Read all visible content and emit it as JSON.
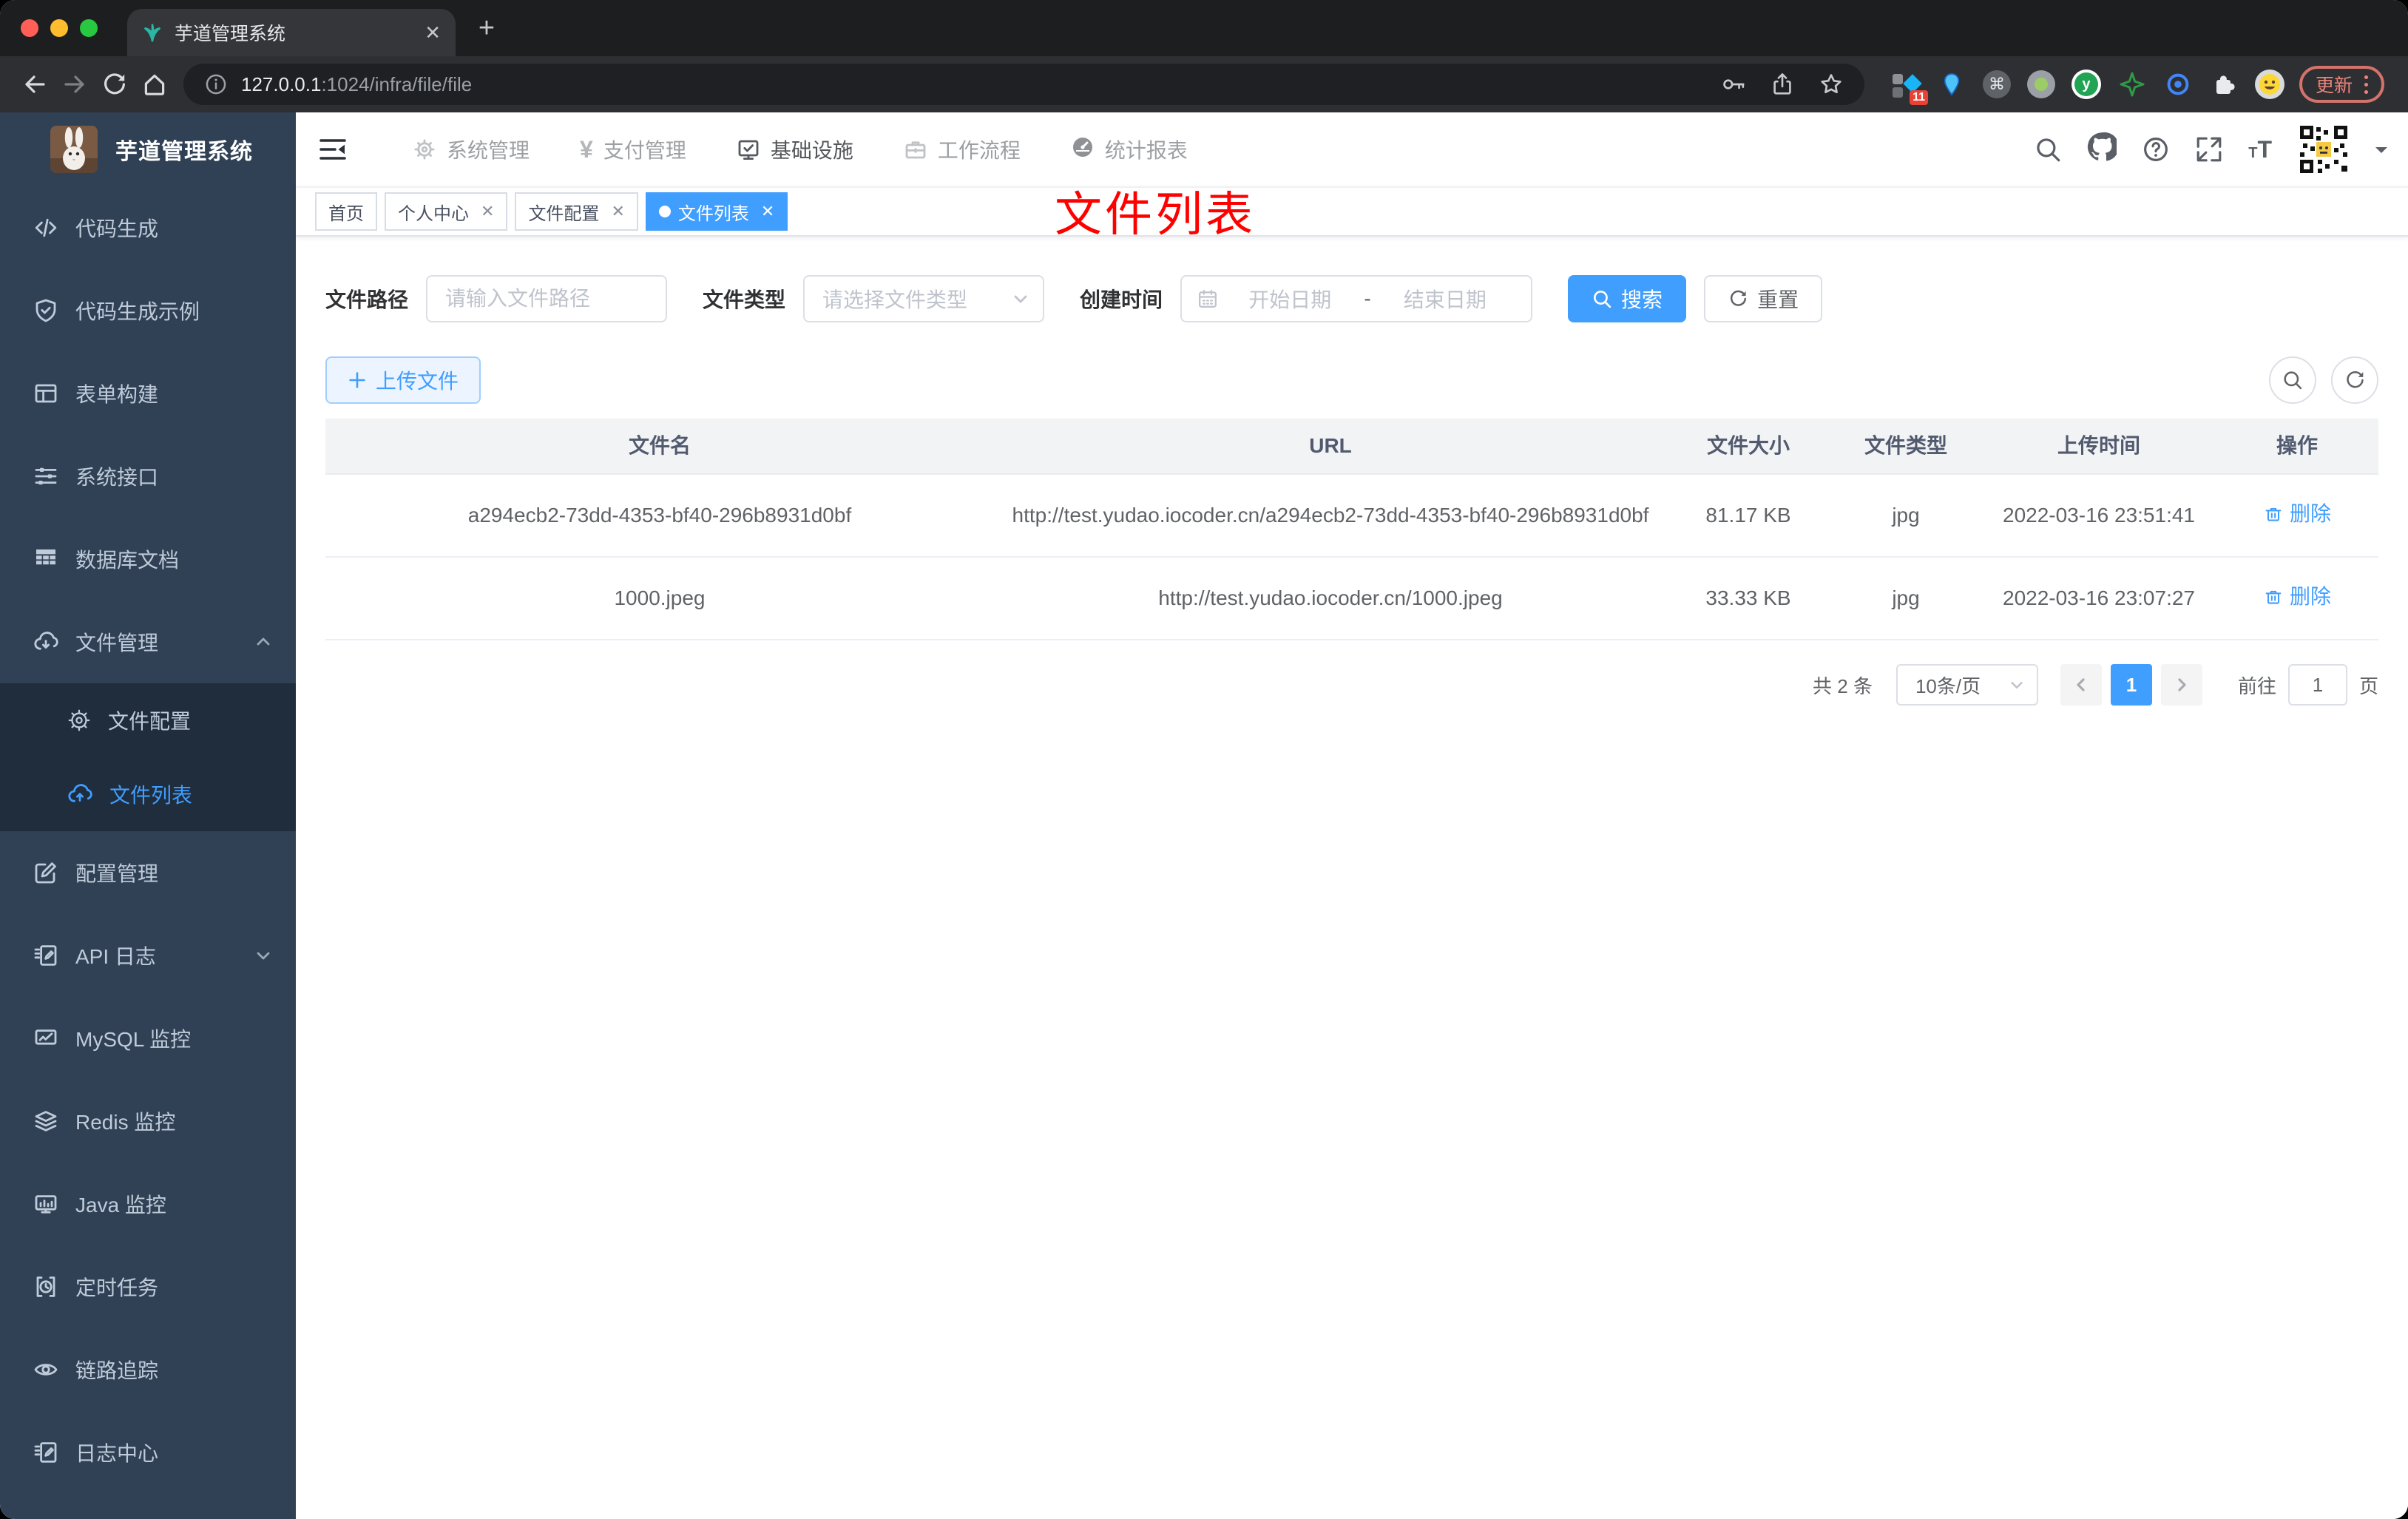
{
  "browser": {
    "tab_title": "芋道管理系统",
    "url_host": "127.0.0.1",
    "url_rest": ":1024/infra/file/file",
    "extension_badge": "11",
    "update_label": "更新"
  },
  "sidebar": {
    "title": "芋道管理系统",
    "items": [
      {
        "label": "代码生成",
        "icon": "code-icon"
      },
      {
        "label": "代码生成示例",
        "icon": "shield-check-icon"
      },
      {
        "label": "表单构建",
        "icon": "form-icon"
      },
      {
        "label": "系统接口",
        "icon": "sliders-icon"
      },
      {
        "label": "数据库文档",
        "icon": "database-table-icon"
      },
      {
        "label": "文件管理",
        "icon": "cloud-download-icon"
      },
      {
        "label": "配置管理",
        "icon": "edit-square-icon"
      },
      {
        "label": "API 日志",
        "icon": "log-edit-icon"
      },
      {
        "label": "MySQL 监控",
        "icon": "monitor-chart-icon"
      },
      {
        "label": "Redis 监控",
        "icon": "layers-icon"
      },
      {
        "label": "Java 监控",
        "icon": "monitor-bars-icon"
      },
      {
        "label": "定时任务",
        "icon": "timer-icon"
      },
      {
        "label": "链路追踪",
        "icon": "eye-icon"
      },
      {
        "label": "日志中心",
        "icon": "log-edit-icon"
      }
    ],
    "submenu": [
      {
        "label": "文件配置",
        "icon": "gear-icon",
        "active": false
      },
      {
        "label": "文件列表",
        "icon": "cloud-upload-icon",
        "active": true
      }
    ]
  },
  "topnav": {
    "items": [
      {
        "label": "系统管理",
        "icon": "gear-icon"
      },
      {
        "label": "支付管理",
        "icon": "yen-icon"
      },
      {
        "label": "基础设施",
        "icon": "monitor-check-icon",
        "active": true
      },
      {
        "label": "工作流程",
        "icon": "briefcase-icon"
      },
      {
        "label": "统计报表",
        "icon": "gauge-icon"
      }
    ]
  },
  "tags": {
    "items": [
      {
        "label": "首页",
        "closable": false,
        "active": false
      },
      {
        "label": "个人中心",
        "closable": true,
        "active": false
      },
      {
        "label": "文件配置",
        "closable": true,
        "active": false
      },
      {
        "label": "文件列表",
        "closable": true,
        "active": true
      }
    ]
  },
  "annotation": {
    "text": "文件列表"
  },
  "filter": {
    "path_label": "文件路径",
    "path_placeholder": "请输入文件路径",
    "type_label": "文件类型",
    "type_placeholder": "请选择文件类型",
    "time_label": "创建时间",
    "start_placeholder": "开始日期",
    "separator": "-",
    "end_placeholder": "结束日期",
    "search_label": "搜索",
    "reset_label": "重置"
  },
  "actions": {
    "upload_label": "上传文件"
  },
  "table": {
    "headers": [
      "文件名",
      "URL",
      "文件大小",
      "文件类型",
      "上传时间",
      "操作"
    ],
    "rows": [
      {
        "name": "a294ecb2-73dd-4353-bf40-296b8931d0bf",
        "url": "http://test.yudao.iocoder.cn/a294ecb2-73dd-4353-bf40-296b8931d0bf",
        "size": "81.17 KB",
        "type": "jpg",
        "time": "2022-03-16 23:51:41",
        "action": "删除"
      },
      {
        "name": "1000.jpeg",
        "url": "http://test.yudao.iocoder.cn/1000.jpeg",
        "size": "33.33 KB",
        "type": "jpg",
        "time": "2022-03-16 23:07:27",
        "action": "删除"
      }
    ]
  },
  "pagination": {
    "total": "共 2 条",
    "page_size": "10条/页",
    "page": "1",
    "goto_label": "前往",
    "goto_value": "1",
    "unit": "页"
  },
  "colors": {
    "accent": "#409eff",
    "annotation": "#ff0000",
    "sidebar_bg": "#304156",
    "submenu_bg": "#1f2d3d",
    "tag_active_bg": "#409eff",
    "update_chip": "#ee8379"
  }
}
